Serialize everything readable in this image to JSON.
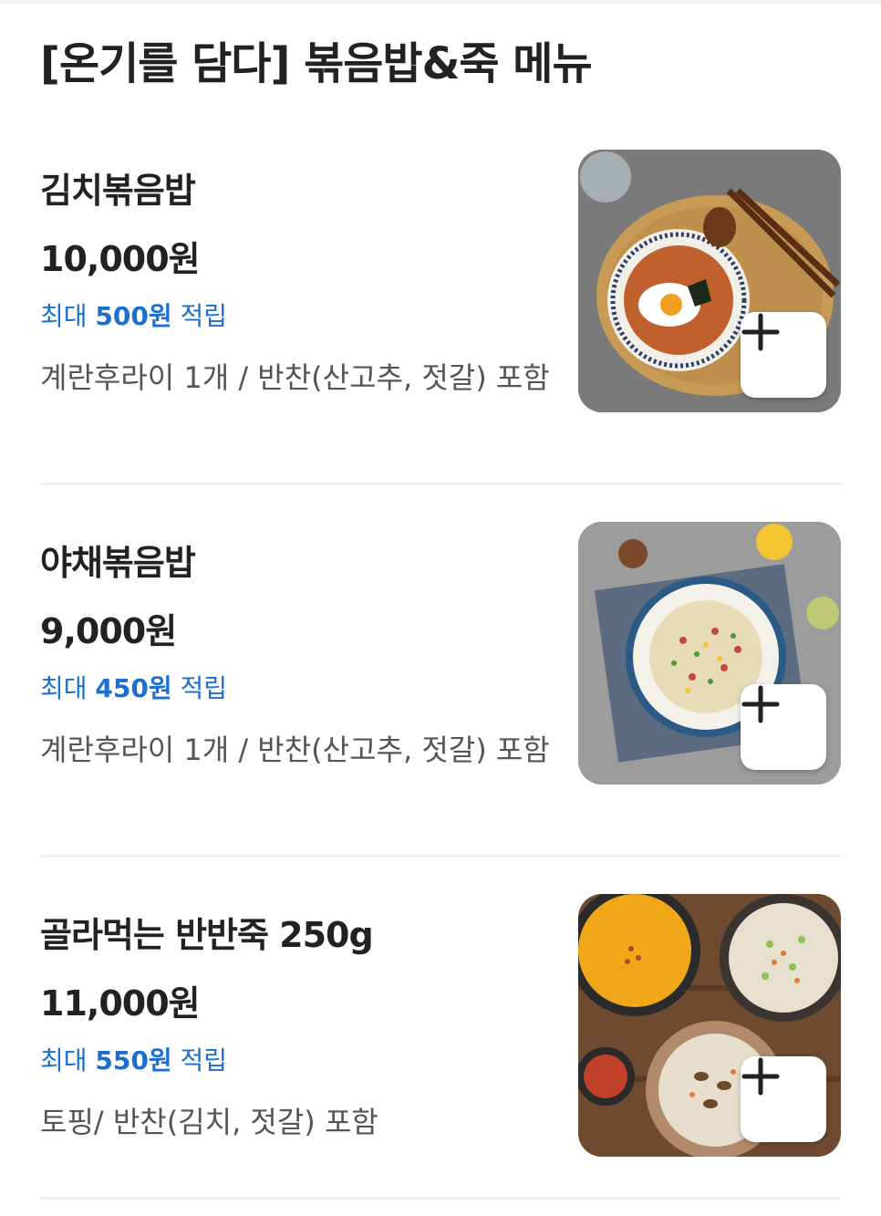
{
  "section": {
    "title": "[온기를 담다] 볶음밥&죽 메뉴"
  },
  "items": [
    {
      "name": "김치볶음밥",
      "price": "10,000원",
      "points_prefix": "최대 ",
      "points_amount": "500원",
      "points_suffix": " 적립",
      "description": "계란후라이 1개 / 반찬(산고추, 젓갈) 포함",
      "image_icon": "kimchi-fried-rice-photo",
      "add_icon": "plus-icon"
    },
    {
      "name": "야채볶음밥",
      "price": "9,000원",
      "points_prefix": "최대 ",
      "points_amount": "450원",
      "points_suffix": " 적립",
      "description": "계란후라이 1개 / 반찬(산고추, 젓갈) 포함",
      "image_icon": "vegetable-fried-rice-photo",
      "add_icon": "plus-icon"
    },
    {
      "name": "골라먹는 반반죽 250g",
      "price": "11,000원",
      "points_prefix": "최대 ",
      "points_amount": "550원",
      "points_suffix": " 적립",
      "description": "토핑/ 반찬(김치, 젓갈) 포함",
      "image_icon": "half-half-porridge-photo",
      "add_icon": "plus-icon"
    }
  ],
  "colors": {
    "points_blue": "#1a6fd1",
    "text_dark": "#222222",
    "text_gray": "#555555",
    "divider": "#f0f0f0"
  }
}
